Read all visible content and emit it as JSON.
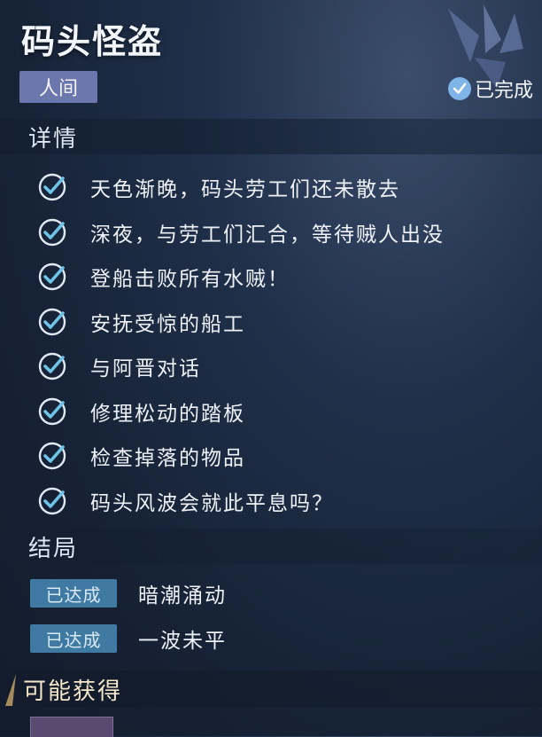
{
  "quest": {
    "title": "码头怪盗",
    "category": "人间",
    "status": "已完成"
  },
  "sections": {
    "details": "详情",
    "ending": "结局",
    "rewards": "可能获得"
  },
  "tasks": [
    {
      "label": "天色渐晚，码头劳工们还未散去",
      "done": true
    },
    {
      "label": "深夜，与劳工们汇合，等待贼人出没",
      "done": true
    },
    {
      "label": "登船击败所有水贼！",
      "done": true
    },
    {
      "label": "安抚受惊的船工",
      "done": true
    },
    {
      "label": "与阿晋对话",
      "done": true
    },
    {
      "label": "修理松动的踏板",
      "done": true
    },
    {
      "label": "检查掉落的物品",
      "done": true
    },
    {
      "label": "码头风波会就此平息吗？",
      "done": true
    }
  ],
  "endings": [
    {
      "badge": "已达成",
      "label": "暗潮涌动"
    },
    {
      "badge": "已达成",
      "label": "一波未平"
    }
  ],
  "colors": {
    "category_bg": "#6c78ad",
    "ending_badge_bg": "#3f7aa3",
    "status_check": "#7fb4e8",
    "rewards_label": "#f5e7c8"
  }
}
